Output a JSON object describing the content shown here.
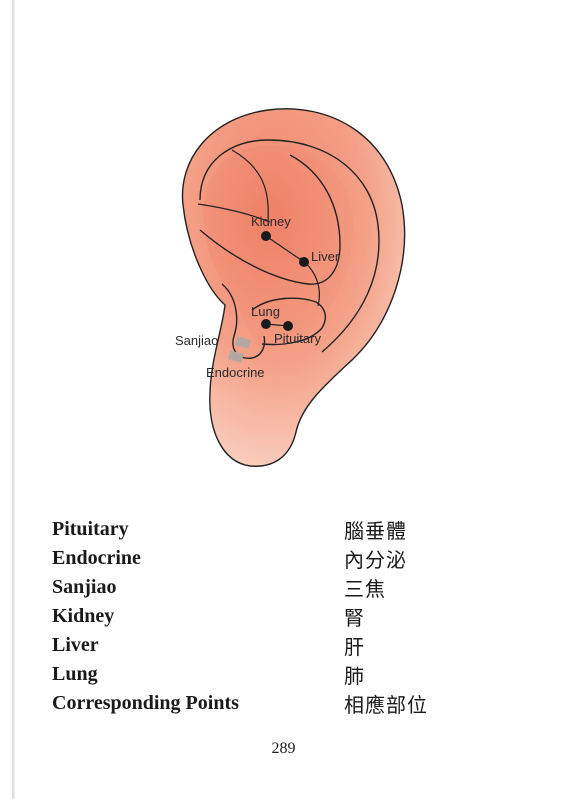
{
  "diagram": {
    "labels": {
      "kidney": "Kidney",
      "liver": "Liver",
      "lung": "Lung",
      "pituitary": "Pituitary",
      "sanjiao": "Sanjiao",
      "endocrine": "Endocrine"
    }
  },
  "glossary": [
    {
      "term": "Pituitary",
      "translation": "腦垂體"
    },
    {
      "term": "Endocrine",
      "translation": "內分泌"
    },
    {
      "term": "Sanjiao",
      "translation": "三焦"
    },
    {
      "term": "Kidney",
      "translation": "腎"
    },
    {
      "term": "Liver",
      "translation": "肝"
    },
    {
      "term": "Lung",
      "translation": "肺"
    },
    {
      "term": "Corresponding Points",
      "translation": "相應部位"
    }
  ],
  "page_number": "289"
}
